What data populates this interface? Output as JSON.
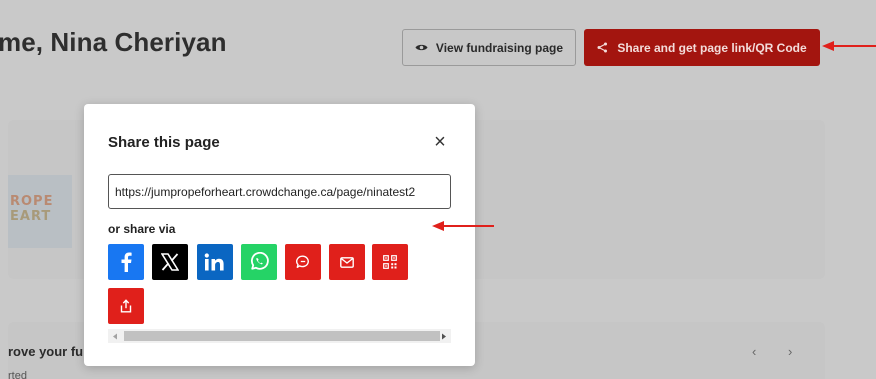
{
  "page": {
    "title": "me, Nina Cheriyan",
    "view_button_label": "View fundraising page",
    "share_button_label": "Share and get page link/QR Code",
    "logo_line1": "ROPE",
    "logo_line2": "EART",
    "improve_text": "rove your fu",
    "started_text": "rted"
  },
  "modal": {
    "title": "Share this page",
    "close_symbol": "×",
    "url_value": "https://jumpropeforheart.crowdchange.ca/page/ninatest2",
    "share_via_label": "or share via",
    "share_buttons": [
      {
        "name": "facebook",
        "icon": "facebook-icon",
        "color": "#1877f2"
      },
      {
        "name": "x",
        "icon": "x-icon",
        "color": "#000000"
      },
      {
        "name": "linkedin",
        "icon": "linkedin-icon",
        "color": "#0a66c2"
      },
      {
        "name": "whatsapp",
        "icon": "whatsapp-icon",
        "color": "#25d366"
      },
      {
        "name": "message",
        "icon": "chat-bubble-icon",
        "color": "#e0201b"
      },
      {
        "name": "email",
        "icon": "mail-icon",
        "color": "#e0201b"
      },
      {
        "name": "qr-code",
        "icon": "qr-code-icon",
        "color": "#e0201b"
      },
      {
        "name": "share",
        "icon": "share-upload-icon",
        "color": "#e0201b"
      }
    ]
  },
  "colors": {
    "primary_red": "#a3150f",
    "annotation_arrow": "#e0201b"
  }
}
